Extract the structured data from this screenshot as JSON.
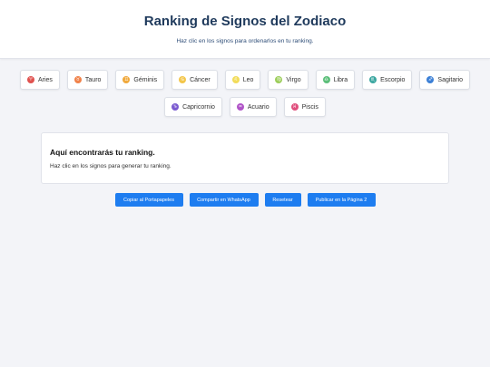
{
  "header": {
    "title": "Ranking de Signos del Zodiaco",
    "subtitle": "Haz clic en los signos para ordenarlos en tu ranking."
  },
  "signs": [
    {
      "label": "Aries",
      "glyph": "♈",
      "color": "#e0524f"
    },
    {
      "label": "Tauro",
      "glyph": "♉",
      "color": "#f0824a"
    },
    {
      "label": "Géminis",
      "glyph": "♊",
      "color": "#f0a83a"
    },
    {
      "label": "Cáncer",
      "glyph": "♋",
      "color": "#f3c64a"
    },
    {
      "label": "Leo",
      "glyph": "♌",
      "color": "#f2dc5a"
    },
    {
      "label": "Virgo",
      "glyph": "♍",
      "color": "#9ccd5a"
    },
    {
      "label": "Libra",
      "glyph": "♎",
      "color": "#5cbf7a"
    },
    {
      "label": "Escorpio",
      "glyph": "♏",
      "color": "#3aa6a0"
    },
    {
      "label": "Sagitario",
      "glyph": "♐",
      "color": "#3b7fd6"
    },
    {
      "label": "Capricornio",
      "glyph": "♑",
      "color": "#7b5bd0"
    },
    {
      "label": "Acuario",
      "glyph": "♒",
      "color": "#b054c8"
    },
    {
      "label": "Piscis",
      "glyph": "♓",
      "color": "#e0507e"
    }
  ],
  "ranking": {
    "title": "Aquí encontrarás tu ranking.",
    "text": "Haz clic en los signos para generar tu ranking."
  },
  "actions": {
    "copy": "Copiar al Portapapeles",
    "share": "Compartir en WhatsApp",
    "reset": "Resetear",
    "publish": "Publicar en la Página 2"
  },
  "colors": {
    "accent": "#1e7df0",
    "title": "#1f3a5c"
  }
}
